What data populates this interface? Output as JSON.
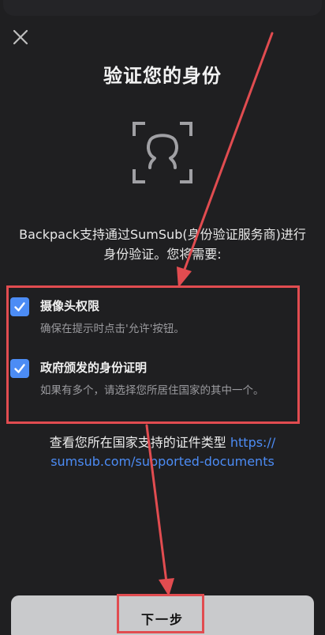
{
  "header": {
    "close_icon": "close-icon",
    "title": "验证您的身份"
  },
  "hero": {
    "icon": "face-scan-icon"
  },
  "intro": {
    "line1": "Backpack支持通过SumSub(身份验证服务商)进行",
    "line2": "身份验证。您将需要:"
  },
  "requirements": [
    {
      "title": "摄像头权限",
      "description": "确保在提示时点击'允许'按钮。",
      "checked": true
    },
    {
      "title": "政府颁发的身份证明",
      "description": "如果有多个，请选择您所居住国家的其中一个。",
      "checked": true
    }
  ],
  "documents": {
    "prefix": "查看您所在国家支持的证件类型",
    "link_part1": "https://",
    "link_part2": "sumsub.com/supported-documents"
  },
  "footer": {
    "next_label": "下一步"
  },
  "colors": {
    "background": "#1f1f21",
    "accent_blue": "#4c8cf5",
    "annotation_red": "#e14c50",
    "button_bg": "#c9cacc"
  }
}
